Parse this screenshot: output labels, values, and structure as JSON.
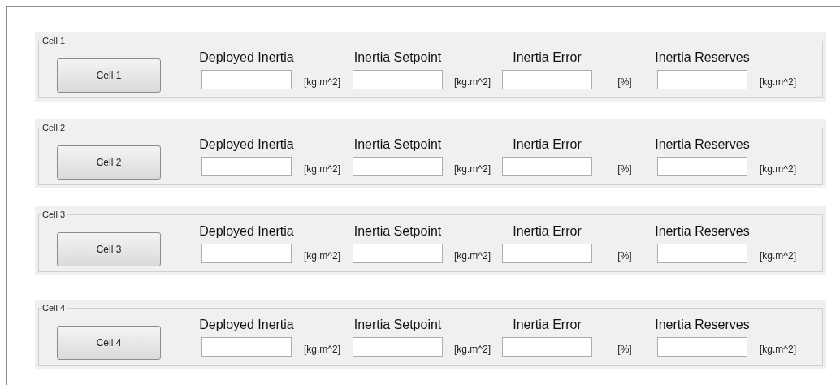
{
  "cells": [
    {
      "legend": "Cell 1",
      "button": "Cell 1",
      "fields": [
        {
          "label": "Deployed Inertia",
          "unit": "[kg.m^2]"
        },
        {
          "label": "Inertia Setpoint",
          "unit": "[kg.m^2]"
        },
        {
          "label": "Inertia Error",
          "unit": "[%]"
        },
        {
          "label": "Inertia Reserves",
          "unit": "[kg.m^2]"
        }
      ]
    },
    {
      "legend": "Cell 2",
      "button": "Cell 2",
      "fields": [
        {
          "label": "Deployed Inertia",
          "unit": "[kg.m^2]"
        },
        {
          "label": "Inertia Setpoint",
          "unit": "[kg.m^2]"
        },
        {
          "label": "Inertia Error",
          "unit": "[%]"
        },
        {
          "label": "Inertia Reserves",
          "unit": "[kg.m^2]"
        }
      ]
    },
    {
      "legend": "Cell 3",
      "button": "Cell 3",
      "fields": [
        {
          "label": "Deployed Inertia",
          "unit": "[kg.m^2]"
        },
        {
          "label": "Inertia Setpoint",
          "unit": "[kg.m^2]"
        },
        {
          "label": "Inertia Error",
          "unit": "[%]"
        },
        {
          "label": "Inertia Reserves",
          "unit": "[kg.m^2]"
        }
      ]
    },
    {
      "legend": "Cell 4",
      "button": "Cell 4",
      "fields": [
        {
          "label": "Deployed Inertia",
          "unit": "[kg.m^2]"
        },
        {
          "label": "Inertia Setpoint",
          "unit": "[kg.m^2]"
        },
        {
          "label": "Inertia Error",
          "unit": "[%]"
        },
        {
          "label": "Inertia Reserves",
          "unit": "[kg.m^2]"
        }
      ]
    }
  ]
}
